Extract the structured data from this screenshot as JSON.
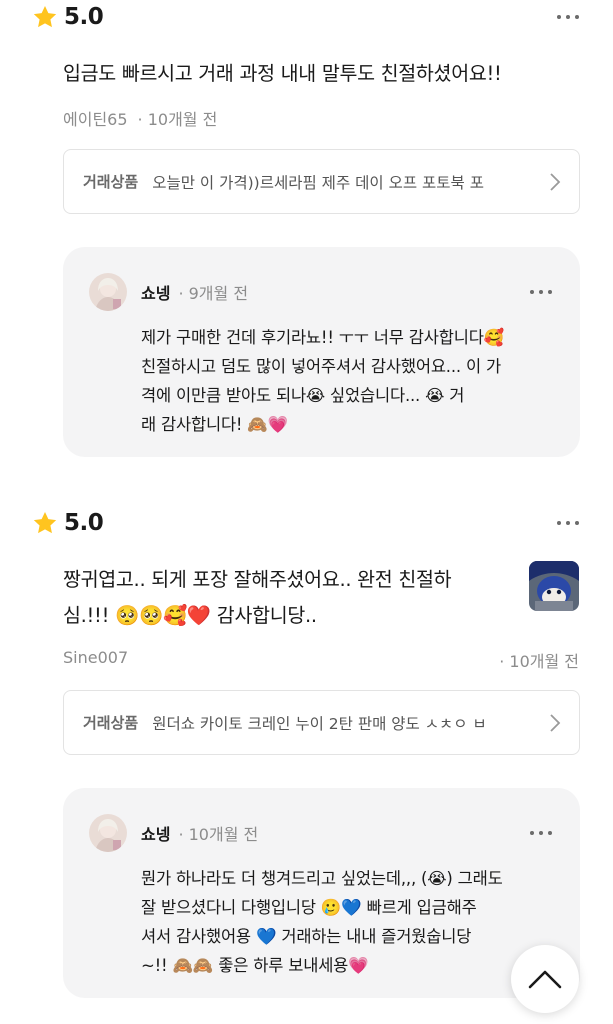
{
  "reviews": [
    {
      "rating": "5.0",
      "text": "입금도 빠르시고 거래 과정 내내 말투도 친절하셨어요!!",
      "author": "에이틴65",
      "time": "· 10개월 전",
      "product_label": "거래상품",
      "product_name": "오늘만 이 가격))르세라핌 제주 데이 오프 포토북 포",
      "reply": {
        "name": "쇼넹",
        "time": "· 9개월 전",
        "lines": [
          "제가 구매한 건데 후기라뇨!! ㅜㅜ 너무 감사합니다🥰",
          "친절하시고 덤도 많이 넣어주셔서 감사했어요... 이 가",
          "격에 이만큼 받아도 되나😭     싶었습니다... 😭     거",
          "래 감사합니다! 🙈💗"
        ]
      }
    },
    {
      "rating": "5.0",
      "text_lines": [
        "짱귀엽고.. 되게 포장 잘해주셨어요.. 완전 친절하",
        "심.!!! 🥺🥺🥰❤️ 감사합니당.."
      ],
      "author": "Sine007",
      "time": "· 10개월 전",
      "product_label": "거래상품",
      "product_name": "원더쇼 카이토 크레인 누이 2탄 판매 양도 ㅅㅊㅇ ㅂ",
      "reply": {
        "name": "쇼넹",
        "time": "· 10개월 전",
        "lines": [
          "뭔가 하나라도 더 챙겨드리고 싶었는데,,, (😭) 그래도",
          "잘 받으셨다니 다행입니당 🥲💙     빠르게 입금해주",
          "셔서 감사했어용 💙     거래하는 내내 즐거웠숩니당",
          "~!! 🙈🙈     좋은 하루 보내세용💗"
        ]
      }
    }
  ],
  "icons": {
    "star": "star-icon",
    "more": "more-dots-icon",
    "chevron": "chevron-right-icon",
    "scroll_top": "chevron-up-icon"
  },
  "colors": {
    "star": "#ffc41f",
    "reply_bg": "#f4f4f5",
    "muted_text": "#8c8c8c"
  }
}
